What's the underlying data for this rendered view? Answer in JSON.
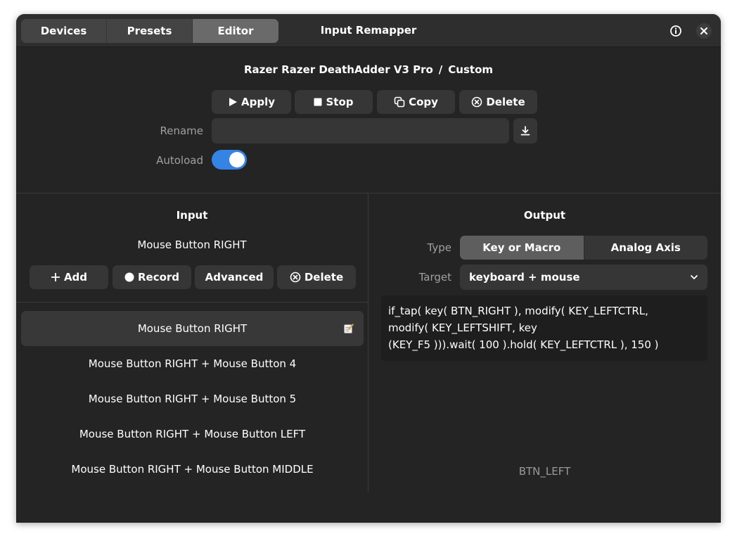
{
  "titlebar": {
    "tabs": [
      {
        "label": "Devices",
        "active": false
      },
      {
        "label": "Presets",
        "active": false
      },
      {
        "label": "Editor",
        "active": true
      }
    ],
    "title": "Input Remapper",
    "info_icon": "info-icon",
    "close_icon": "close-icon"
  },
  "header": {
    "device": "Razer Razer DeathAdder V3 Pro",
    "separator": "/",
    "preset": "Custom",
    "buttons": {
      "apply": "Apply",
      "stop": "Stop",
      "copy": "Copy",
      "delete": "Delete"
    },
    "rename_label": "Rename",
    "rename_value": "",
    "autoload_label": "Autoload",
    "autoload_on": true
  },
  "input": {
    "title": "Input",
    "current": "Mouse Button RIGHT",
    "buttons": {
      "add": "Add",
      "record": "Record",
      "advanced": "Advanced",
      "delete": "Delete"
    },
    "combinations": [
      "Mouse Button RIGHT",
      "Mouse Button RIGHT + Mouse Button 4",
      "Mouse Button RIGHT + Mouse Button 5",
      "Mouse Button RIGHT + Mouse Button LEFT",
      "Mouse Button RIGHT + Mouse Button MIDDLE"
    ]
  },
  "output": {
    "title": "Output",
    "type_label": "Type",
    "type_options": [
      "Key or Macro",
      "Analog Axis"
    ],
    "type_selected": "Key or Macro",
    "target_label": "Target",
    "target_value": "keyboard + mouse",
    "macro_lines": [
      "if_tap( key( BTN_RIGHT ), modify( KEY_LEFTCTRL,",
      "modify( KEY_LEFTSHIFT, key",
      "(KEY_F5 ))).wait( 100 ).hold( KEY_LEFTCTRL ), 150 )"
    ],
    "footer": "BTN_LEFT"
  },
  "colors": {
    "accent": "#3584e4",
    "window_bg": "#242424",
    "button_bg": "#363636"
  }
}
